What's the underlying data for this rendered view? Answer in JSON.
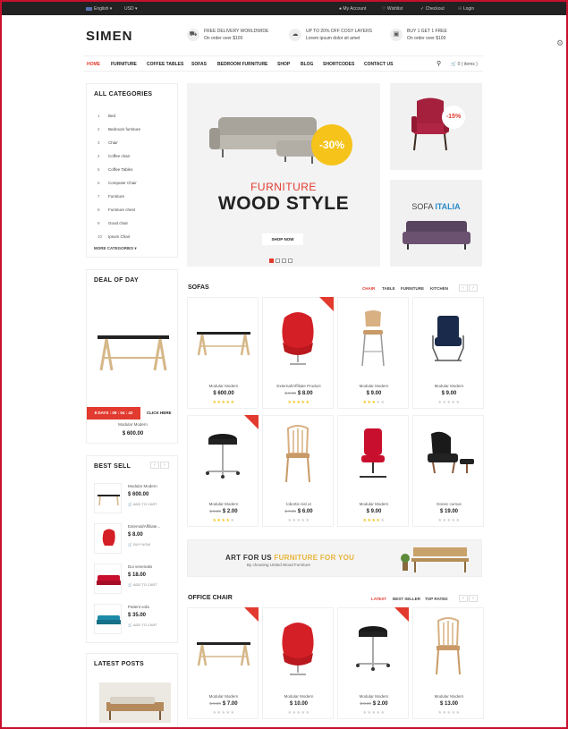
{
  "topbar": {
    "language": "English",
    "currency": "USD",
    "links": [
      {
        "label": "My Account",
        "icon": "user-icon"
      },
      {
        "label": "Wishlist",
        "icon": "heart-icon"
      },
      {
        "label": "Checkout",
        "icon": "check-icon"
      },
      {
        "label": "Login",
        "icon": "lock-icon"
      }
    ]
  },
  "header": {
    "logo": "SIMEN",
    "promos": [
      {
        "title": "FREE DELIVERY WORLDWIDE",
        "sub": "On order over $100"
      },
      {
        "title": "UP TO 20% OFF COSY LAYERS",
        "sub": "Lorem ipsum dolor sit amet"
      },
      {
        "title": "BUY 1 GET 1 FREE",
        "sub": "On order over $100"
      }
    ]
  },
  "nav": {
    "items": [
      "HOME",
      "FURNITURE",
      "COFFEE TABLES",
      "SOFAS",
      "BEDROOM FURNITURE",
      "SHOP",
      "BLOG",
      "SHORTCODES",
      "CONTACT US"
    ],
    "active": "HOME",
    "cart_label": "0 ( items )"
  },
  "categories": {
    "title": "ALL CATEGORIES",
    "items": [
      {
        "num": "1",
        "label": "Bed"
      },
      {
        "num": "2",
        "label": "Bedroom furniture"
      },
      {
        "num": "3",
        "label": "Chair"
      },
      {
        "num": "4",
        "label": "Coffee chair"
      },
      {
        "num": "5",
        "label": "Coffee Tables"
      },
      {
        "num": "6",
        "label": "Computer Chair"
      },
      {
        "num": "7",
        "label": "Furniture"
      },
      {
        "num": "8",
        "label": "Furniture chest"
      },
      {
        "num": "9",
        "label": "Good chair"
      },
      {
        "num": "10",
        "label": "Ipsum Chair"
      }
    ],
    "more": "MORE CATEGORIES"
  },
  "slider": {
    "badge": "-30%",
    "line1": "FURNITURE",
    "line2": "WOOD STYLE",
    "button": "SHOP NOW"
  },
  "side_banners": {
    "badge": "-15%",
    "sofa_word": "SOFA",
    "italia_word": "ITALIA"
  },
  "deal": {
    "title": "DEAL OF DAY",
    "countdown": "8 DAYS : 09 : 04 : 42",
    "click": "CLICK HERE",
    "product": "Modular Modern",
    "price": "$ 600.00"
  },
  "sofas": {
    "title": "SOFAS",
    "tabs": [
      "CHAIR",
      "TABLE",
      "FURNITURE",
      "KITCHEN"
    ],
    "products": [
      {
        "name": "Modular Modern",
        "old": "",
        "price": "$ 600.00",
        "rating": 5,
        "sale": false,
        "img": "table"
      },
      {
        "name": "External/Affiliate Product",
        "old": "$ 9.00",
        "price": "$ 8.00",
        "rating": 5,
        "sale": true,
        "img": "egg"
      },
      {
        "name": "Modular Modern",
        "old": "",
        "price": "$ 9.00",
        "rating": 3,
        "sale": false,
        "img": "stool"
      },
      {
        "name": "Modular Modern",
        "old": "",
        "price": "$ 9.00",
        "rating": 0,
        "sale": false,
        "img": "office"
      },
      {
        "name": "Modular Modern",
        "old": "$ 3.00",
        "price": "$ 2.00",
        "rating": 4,
        "sale": true,
        "img": "round-stool"
      },
      {
        "name": "lobortis nisl ut",
        "old": "$ 7.00",
        "price": "$ 6.00",
        "rating": 0,
        "sale": false,
        "img": "wood-chair"
      },
      {
        "name": "Modular Modern",
        "old": "",
        "price": "$ 9.00",
        "rating": 4,
        "sale": false,
        "img": "red-office"
      },
      {
        "name": "Donec cursus",
        "old": "",
        "price": "$ 19.00",
        "rating": 0,
        "sale": false,
        "img": "lounge"
      }
    ]
  },
  "best_sell": {
    "title": "BEST SELL",
    "items": [
      {
        "name": "Modular Modern",
        "price": "$ 600.00",
        "action": "ADD TO CART",
        "img": "table"
      },
      {
        "name": "External/Affiliate...",
        "price": "$ 8.00",
        "action": "BUY NOW",
        "img": "egg"
      },
      {
        "name": "Dui venenatis",
        "price": "$ 18.00",
        "action": "ADD TO CART",
        "img": "red-sofa"
      },
      {
        "name": "Patient sofa",
        "price": "$ 35.00",
        "action": "ADD TO CART",
        "img": "blue-sofa"
      }
    ]
  },
  "banner2": {
    "part1": "ART FOR US",
    "part2": "FURNITURE FOR YOU",
    "sub": "By choosing United Wood Furniture"
  },
  "office_chair": {
    "title": "OFFICE CHAIR",
    "tabs": [
      "LATEST",
      "BEST SELLER",
      "TOP RATED"
    ],
    "products": [
      {
        "name": "Modular Modern",
        "old": "$ 9.00",
        "price": "$ 7.00",
        "rating": 0,
        "sale": true,
        "img": "table"
      },
      {
        "name": "Modular Modern",
        "old": "",
        "price": "$ 10.00",
        "rating": 0,
        "sale": false,
        "img": "egg"
      },
      {
        "name": "Modular Modern",
        "old": "$ 3.00",
        "price": "$ 2.00",
        "rating": 0,
        "sale": true,
        "img": "round-stool"
      },
      {
        "name": "Modular Modern",
        "old": "",
        "price": "$ 13.00",
        "rating": 0,
        "sale": false,
        "img": "wood-chair"
      }
    ]
  },
  "latest_posts": {
    "title": "LATEST POSTS"
  },
  "colors": {
    "accent": "#e23a2e",
    "yellow": "#f5c31a",
    "blue": "#2a8bc9"
  }
}
